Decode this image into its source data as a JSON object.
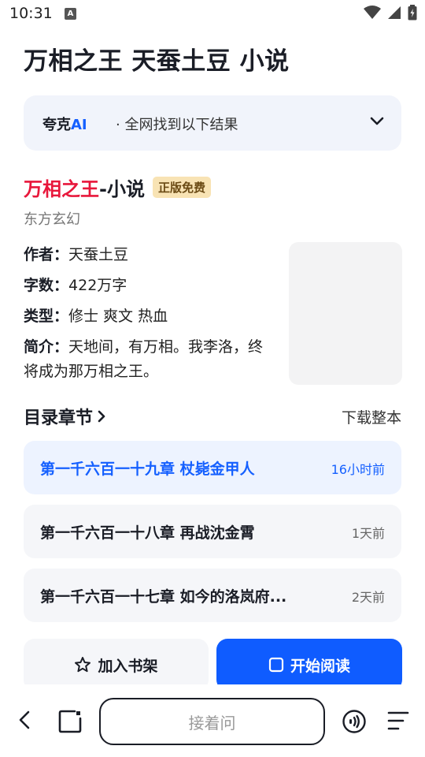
{
  "status": {
    "time": "10:31",
    "notif_letter": "A"
  },
  "query": "万相之王 天蚕土豆 小说",
  "ai_card": {
    "brand_prefix": "夸克",
    "brand_ai": "AI",
    "summary": "· 全网找到以下结果"
  },
  "book": {
    "title_red": "万相之王",
    "title_rest": "-小说",
    "badge": "正版免费",
    "genre": "东方玄幻",
    "author_label": "作者：",
    "author": "天蚕土豆",
    "words_label": "字数：",
    "words": "422万字",
    "type_label": "类型：",
    "type": "修士 爽文 热血",
    "intro_label": "简介：",
    "intro": "天地间，有万相。我李洛，终将成为那万相之王。"
  },
  "toc": {
    "title": "目录章节",
    "download": "下载整本",
    "chapters": [
      {
        "name": "第一千六百一十九章 杖毙金甲人",
        "time": "16小时前"
      },
      {
        "name": "第一千六百一十八章 再战沈金霄",
        "time": "1天前"
      },
      {
        "name": "第一千六百一十七章 如今的洛岚府...",
        "time": "2天前"
      }
    ]
  },
  "actions": {
    "shelf": "加入书架",
    "read": "开始阅读"
  },
  "bottom": {
    "ask_placeholder": "接着问"
  },
  "colors": {
    "accent": "#0f5cff",
    "title_red": "#e8173b",
    "badge_bg": "#f8e3b4"
  },
  "icons": [
    "wifi-icon",
    "signal-icon",
    "battery-icon",
    "chevron-down-icon",
    "chevron-right-icon",
    "star-icon",
    "book-icon",
    "back-icon",
    "tabs-icon",
    "voice-icon",
    "menu-icon"
  ]
}
